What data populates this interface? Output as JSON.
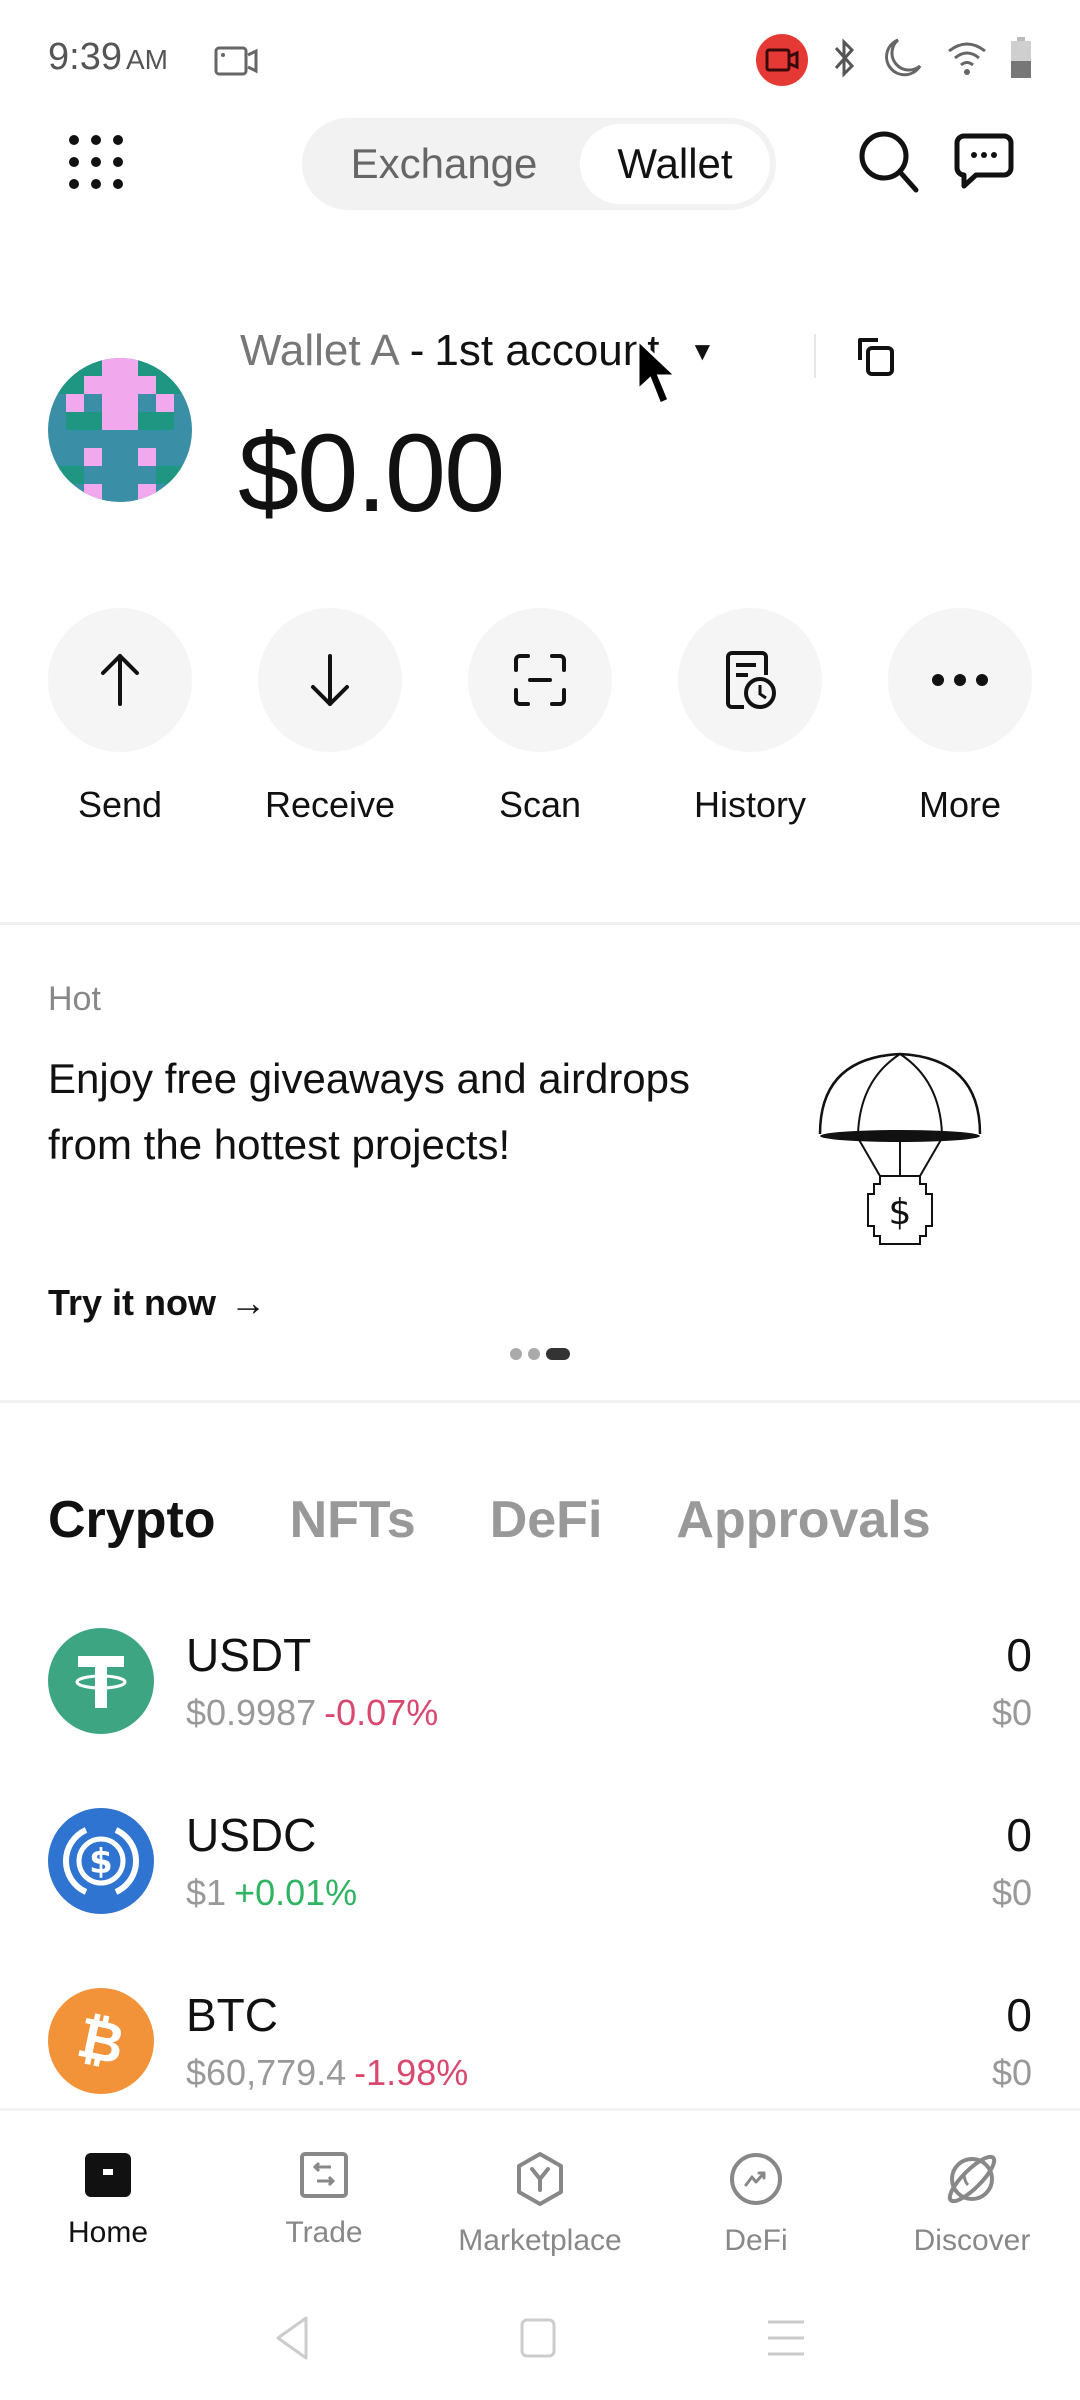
{
  "status_bar": {
    "time": "9:39",
    "ampm": "AM",
    "icons": [
      "screen-record-icon",
      "bluetooth-icon",
      "do-not-disturb-icon",
      "wifi-icon",
      "battery-icon"
    ]
  },
  "top_bar": {
    "segments": [
      {
        "label": "Exchange",
        "active": false
      },
      {
        "label": "Wallet",
        "active": true
      }
    ]
  },
  "wallet": {
    "name": "Wallet A",
    "separator": "-",
    "account": "1st account",
    "balance": "$0.00"
  },
  "actions": [
    {
      "label": "Send",
      "icon": "arrow-up-icon"
    },
    {
      "label": "Receive",
      "icon": "arrow-down-icon"
    },
    {
      "label": "Scan",
      "icon": "scan-icon"
    },
    {
      "label": "History",
      "icon": "history-icon"
    },
    {
      "label": "More",
      "icon": "more-icon"
    }
  ],
  "promo": {
    "tag": "Hot",
    "text": "Enjoy free giveaways and airdrops from the hottest projects!",
    "cta": "Try it now",
    "cta_arrow": "→",
    "pages": 3,
    "active_page": 3
  },
  "asset_tabs": [
    {
      "label": "Crypto",
      "active": true
    },
    {
      "label": "NFTs",
      "active": false
    },
    {
      "label": "DeFi",
      "active": false
    },
    {
      "label": "Approvals",
      "active": false
    }
  ],
  "assets": [
    {
      "symbol": "USDT",
      "price": "$0.9987",
      "change": "-0.07%",
      "direction": "down",
      "quantity": "0",
      "value": "$0",
      "color": "#3da582"
    },
    {
      "symbol": "USDC",
      "price": "$1",
      "change": "+0.01%",
      "direction": "up",
      "quantity": "0",
      "value": "$0",
      "color": "#2e74d0"
    },
    {
      "symbol": "BTC",
      "price": "$60,779.4",
      "change": "-1.98%",
      "direction": "down",
      "quantity": "0",
      "value": "$0",
      "color": "#f2933a"
    }
  ],
  "bottom_nav": [
    {
      "label": "Home",
      "active": true
    },
    {
      "label": "Trade",
      "active": false
    },
    {
      "label": "Marketplace",
      "active": false
    },
    {
      "label": "DeFi",
      "active": false
    },
    {
      "label": "Discover",
      "active": false
    }
  ],
  "colors": {
    "negative": "#d9486f",
    "positive": "#2fb463",
    "record": "#e53935"
  }
}
